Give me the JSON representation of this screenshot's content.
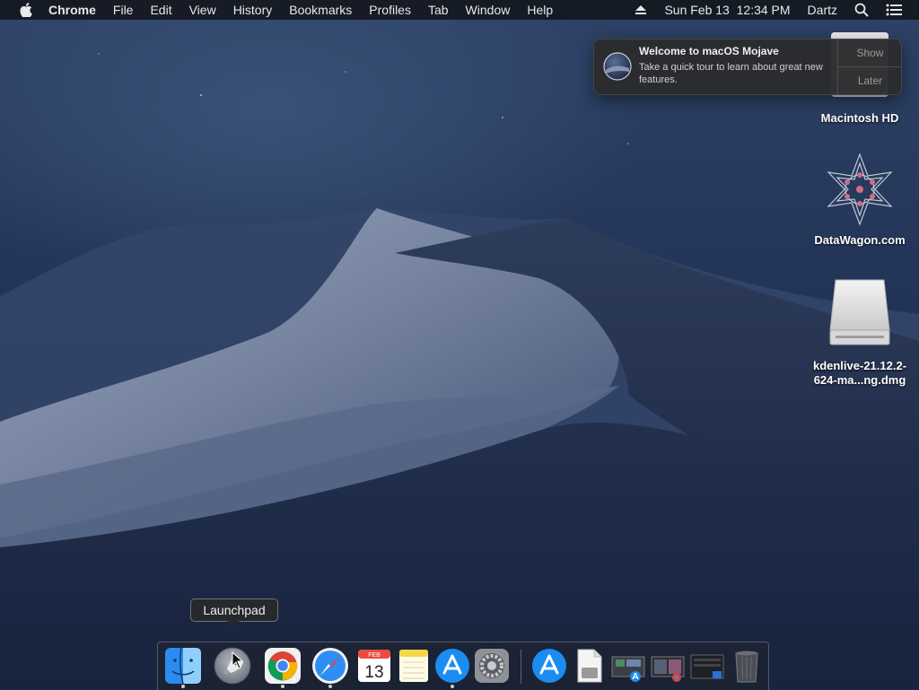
{
  "menubar": {
    "app_name": "Chrome",
    "items": [
      "File",
      "Edit",
      "View",
      "History",
      "Bookmarks",
      "Profiles",
      "Tab",
      "Window",
      "Help"
    ],
    "clock": "Sun Feb 13  12:34 PM",
    "user": "Dartz"
  },
  "notification": {
    "title": "Welcome to macOS Mojave",
    "body": "Take a quick tour to learn about great new features.",
    "show_label": "Show",
    "later_label": "Later"
  },
  "desktop": {
    "icons": [
      {
        "name": "macintosh-hd",
        "label": "Macintosh HD"
      },
      {
        "name": "datawagon",
        "label": "DataWagon.com"
      },
      {
        "name": "kdenlive-dmg",
        "label": "kdenlive-21.12.2-624-ma...ng.dmg"
      }
    ]
  },
  "tooltip": {
    "label": "Launchpad"
  },
  "dock": {
    "calendar_month": "FEB",
    "calendar_day": "13"
  }
}
